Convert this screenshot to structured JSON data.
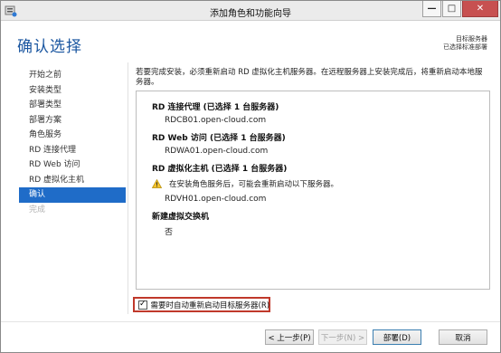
{
  "window": {
    "title": "添加角色和功能向导",
    "controls": {
      "minimize": "—",
      "maximize": "□",
      "close": "✕"
    }
  },
  "header": {
    "page_title": "确认选择",
    "destination_label": "目标服务器",
    "destination_value": "已选择标准部署"
  },
  "nav": {
    "items": [
      {
        "label": "开始之前",
        "state": "normal"
      },
      {
        "label": "安装类型",
        "state": "normal"
      },
      {
        "label": "部署类型",
        "state": "normal"
      },
      {
        "label": "部署方案",
        "state": "normal"
      },
      {
        "label": "角色服务",
        "state": "normal"
      },
      {
        "label": "RD 连接代理",
        "state": "normal"
      },
      {
        "label": "RD Web 访问",
        "state": "normal"
      },
      {
        "label": "RD 虚拟化主机",
        "state": "normal"
      },
      {
        "label": "确认",
        "state": "active"
      },
      {
        "label": "完成",
        "state": "disabled"
      }
    ]
  },
  "content": {
    "intro": "若要完成安装，必须重新启动 RD 虚拟化主机服务器。在远程服务器上安装完成后，将重新启动本地服务器。",
    "sections": [
      {
        "heading": "RD 连接代理 (已选择 1 台服务器)",
        "value": "RDCB01.open-cloud.com"
      },
      {
        "heading": "RD Web 访问 (已选择 1 台服务器)",
        "value": "RDWA01.open-cloud.com"
      },
      {
        "heading": "RD 虚拟化主机 (已选择 1 台服务器)",
        "warning": "在安装角色服务后，可能会重新启动以下服务器。",
        "value": "RDVH01.open-cloud.com"
      },
      {
        "heading": "新建虚拟交换机",
        "value": "否"
      }
    ],
    "restart_checkbox": {
      "label": "需要时自动重新启动目标服务器(R)",
      "checked": true
    }
  },
  "footer": {
    "prev": "< 上一步(P)",
    "next": "下一步(N) >",
    "deploy": "部署(D)",
    "cancel": "取消"
  },
  "colors": {
    "title_blue": "#1a56a0",
    "nav_active": "#1f6cc8",
    "highlight_red": "#c0392b",
    "close_red": "#c75050"
  }
}
